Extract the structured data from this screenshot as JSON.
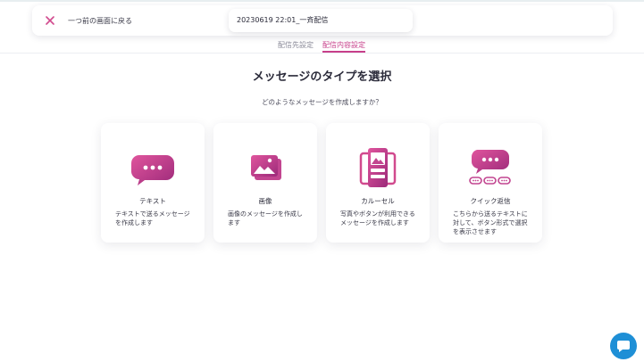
{
  "header": {
    "back_label": "一つ前の画面に戻る",
    "title": "20230619 22:01_一斉配信"
  },
  "tabs": [
    {
      "label": "配信先設定",
      "active": false
    },
    {
      "label": "配信内容設定",
      "active": true
    }
  ],
  "main": {
    "title": "メッセージのタイプを選択",
    "subtitle": "どのようなメッセージを作成しますか？"
  },
  "cards": [
    {
      "icon": "text-message-icon",
      "title": "テキスト",
      "description": "テキストで送るメッセージを作成します"
    },
    {
      "icon": "image-icon",
      "title": "画像",
      "description": "画像のメッセージを作成します"
    },
    {
      "icon": "carousel-icon",
      "title": "カルーセル",
      "description": "写真やボタンが利用できるメッセージを作成します"
    },
    {
      "icon": "quick-reply-icon",
      "title": "クイック返信",
      "description": "こちらから送るテキストに対して、ボタン形式で選択を表示させます"
    }
  ],
  "colors": {
    "accent": "#c73f8a",
    "gradient_start": "#e0559d",
    "gradient_end": "#9c2a7a",
    "chat_button": "#1e8fd6"
  }
}
